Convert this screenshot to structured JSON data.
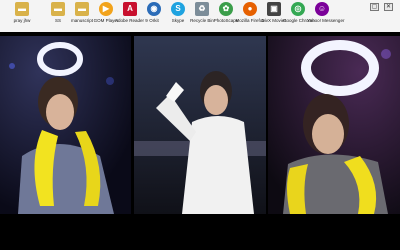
{
  "desktop": {
    "icons": [
      {
        "label": "pray jhw",
        "icon": "folder-icon",
        "color": "#d9b24a"
      },
      {
        "label": "SS",
        "icon": "folder-icon",
        "color": "#d9b24a"
      },
      {
        "label": "manuscript",
        "icon": "folder-icon",
        "color": "#d9b24a"
      },
      {
        "label": "GOM Player",
        "icon": "gom-player-icon",
        "color": "#f2a31b"
      },
      {
        "label": "Adobe Reader 9",
        "icon": "adobe-reader-icon",
        "color": "#c8102e"
      },
      {
        "label": "Orkit",
        "icon": "orkit-icon",
        "color": "#2b6cb8"
      },
      {
        "label": "Skype",
        "icon": "skype-icon",
        "color": "#1fa3e0"
      },
      {
        "label": "Recycle Bin",
        "icon": "recycle-bin-icon",
        "color": "#7c8d99"
      },
      {
        "label": "PhotoScape",
        "icon": "photoscape-icon",
        "color": "#3b9e4a"
      },
      {
        "label": "Mozilla Firefox",
        "icon": "firefox-icon",
        "color": "#e66000"
      },
      {
        "label": "DivX Movies",
        "icon": "divx-icon",
        "color": "#444444"
      },
      {
        "label": "Google Chrome",
        "icon": "chrome-icon",
        "color": "#34a853"
      },
      {
        "label": "Yahoo! Messenger",
        "icon": "yahoo-messenger-icon",
        "color": "#7b0099"
      }
    ],
    "colors": {
      "bar_bg": "#f4f4f4",
      "wallpaper_bg": "#000000"
    }
  }
}
